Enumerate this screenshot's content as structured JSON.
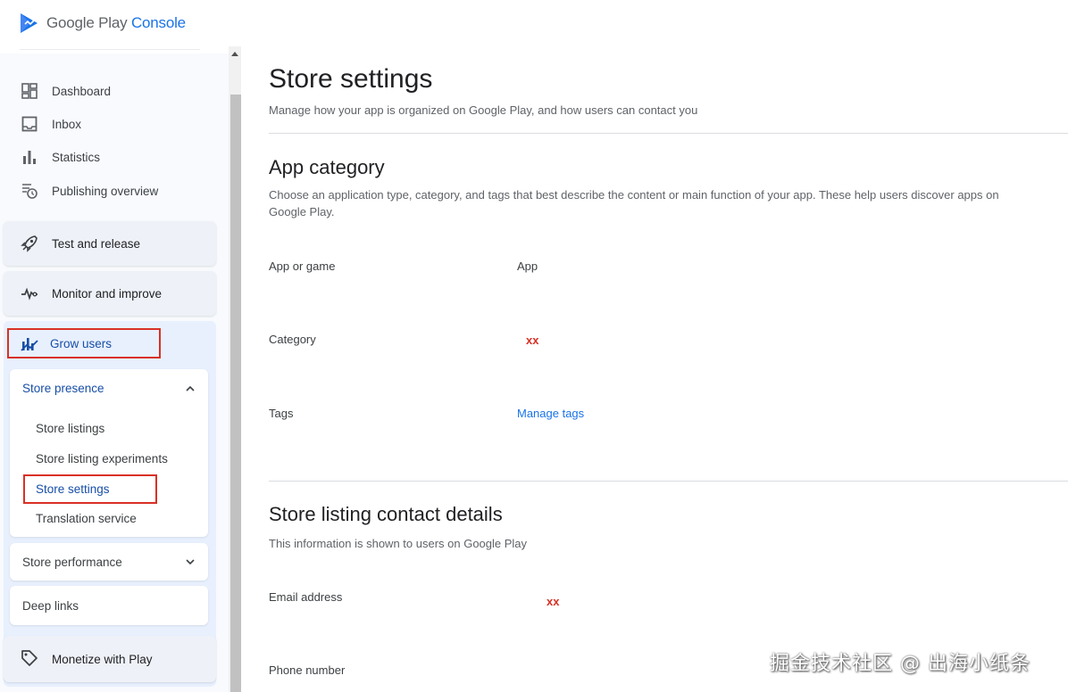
{
  "brand": {
    "google_play": "Google Play",
    "console": "Console"
  },
  "sidebar": {
    "items": [
      {
        "label": "Dashboard",
        "icon": "dashboard-icon"
      },
      {
        "label": "Inbox",
        "icon": "inbox-icon"
      },
      {
        "label": "Statistics",
        "icon": "bar-chart-icon"
      },
      {
        "label": "Publishing overview",
        "icon": "publishing-overview-icon"
      }
    ],
    "sections": {
      "test_release": "Test and release",
      "monitor": "Monitor and improve",
      "grow": "Grow users",
      "monetize": "Monetize with Play"
    },
    "store_presence": {
      "label": "Store presence",
      "items": [
        "Store listings",
        "Store listing experiments",
        "Store settings",
        "Translation service"
      ],
      "active": "Store settings"
    },
    "store_performance": "Store performance",
    "deep_links": "Deep links"
  },
  "main": {
    "title": "Store settings",
    "subtitle": "Manage how your app is organized on Google Play, and how users can contact you",
    "app_category": {
      "title": "App category",
      "description": "Choose an application type, category, and tags that best describe the content or main function of your app. These help users discover apps on Google Play.",
      "fields": [
        {
          "label": "App or game",
          "value": "App"
        },
        {
          "label": "Category",
          "value": "xx"
        },
        {
          "label": "Tags",
          "value": "Manage tags"
        }
      ]
    },
    "contact": {
      "title": "Store listing contact details",
      "description": "This information is shown to users on Google Play",
      "fields": [
        {
          "label": "Email address",
          "value": "xx"
        },
        {
          "label": "Phone number",
          "value": ""
        }
      ]
    }
  },
  "watermark": "掘金技术社区 @ 出海小纸条",
  "colors": {
    "accent": "#1a73e8",
    "highlight": "#d93025",
    "active_bg": "#e8f0fe"
  }
}
